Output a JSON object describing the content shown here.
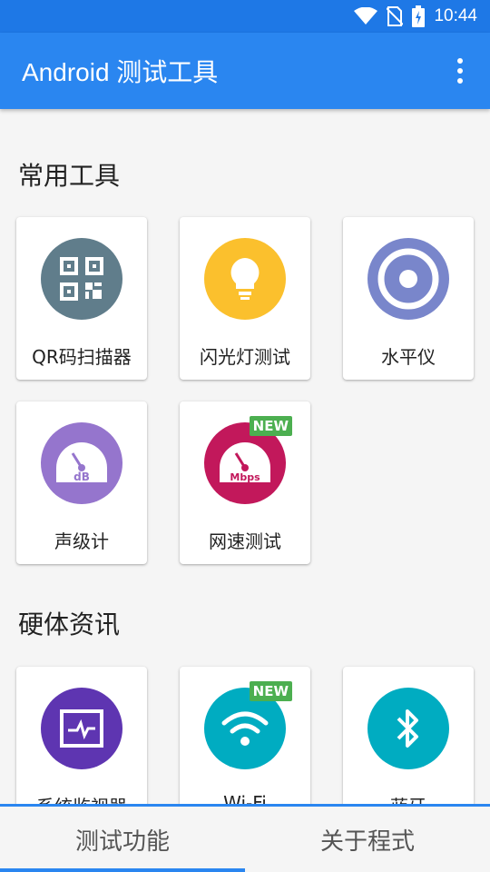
{
  "status_bar": {
    "time": "10:44",
    "icons": [
      "wifi-icon",
      "no-sim-icon",
      "battery-charging-icon"
    ]
  },
  "app_bar": {
    "title": "Android 测试工具",
    "menu_icon": "more-vert-icon"
  },
  "sections": [
    {
      "title": "常用工具",
      "items": [
        {
          "label": "QR码扫描器",
          "icon": "qr-code-icon",
          "color": "#607d8b",
          "badge": ""
        },
        {
          "label": "闪光灯测试",
          "icon": "lightbulb-icon",
          "color": "#fbc02d",
          "badge": ""
        },
        {
          "label": "水平仪",
          "icon": "level-target-icon",
          "color": "#7986cb",
          "badge": ""
        },
        {
          "label": "声级计",
          "icon": "sound-meter-icon",
          "color": "#9575cd",
          "badge": "",
          "gauge_text": "dB"
        },
        {
          "label": "网速测试",
          "icon": "speed-meter-icon",
          "color": "#c2185b",
          "badge": "NEW",
          "gauge_text": "Mbps"
        }
      ]
    },
    {
      "title": "硬体资讯",
      "items": [
        {
          "label": "系统监视器",
          "icon": "system-monitor-icon",
          "color": "#5e35b1",
          "badge": ""
        },
        {
          "label": "Wi-Fi",
          "icon": "wifi-icon",
          "color": "#00acc1",
          "badge": "NEW"
        },
        {
          "label": "蓝牙",
          "icon": "bluetooth-icon",
          "color": "#00acc1",
          "badge": ""
        }
      ]
    }
  ],
  "bottom_nav": {
    "tabs": [
      {
        "label": "测试功能",
        "active": true
      },
      {
        "label": "关于程式",
        "active": false
      }
    ]
  }
}
